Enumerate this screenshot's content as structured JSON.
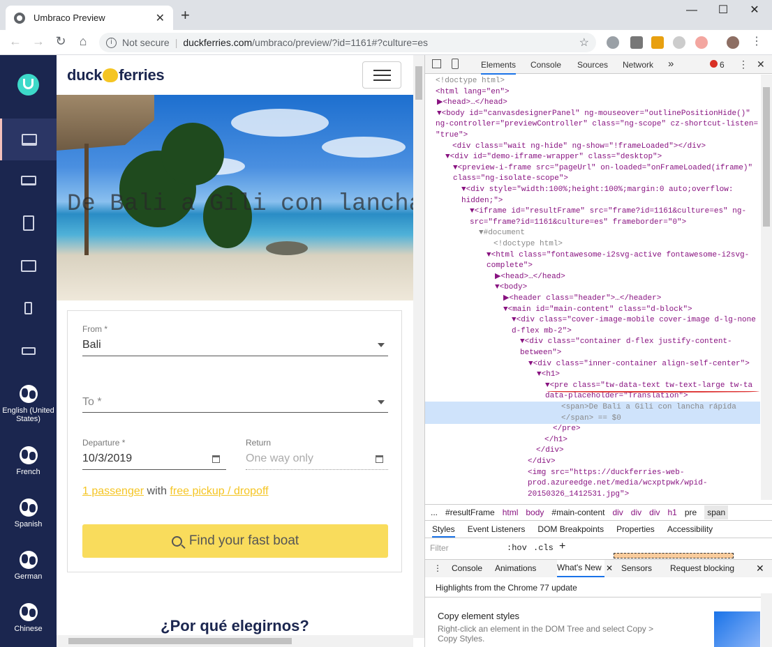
{
  "browser": {
    "tab_title": "Umbraco Preview",
    "tab_close": "✕",
    "new_tab": "+",
    "win_min": "—",
    "win_max": "☐",
    "win_close": "✕",
    "back": "←",
    "forward": "→",
    "reload": "↻",
    "home": "⌂",
    "not_secure": "Not secure",
    "sep": "|",
    "url_domain": "duckferries.com",
    "url_path": "/umbraco/preview/?id=1161#?culture=es",
    "star": "☆",
    "menu": "⋮"
  },
  "sidebar": {
    "languages": [
      {
        "label": "English (United States)"
      },
      {
        "label": "French"
      },
      {
        "label": "Spanish"
      },
      {
        "label": "German"
      },
      {
        "label": "Chinese"
      }
    ]
  },
  "site": {
    "brand_left": "duck",
    "brand_right": "ferries",
    "hero_title": "De Bali a Gili con lancha rápida",
    "from_label": "From *",
    "from_value": "Bali",
    "to_placeholder": "To *",
    "departure_label": "Departure *",
    "departure_value": "10/3/2019",
    "return_label": "Return",
    "return_placeholder": "One way only",
    "passenger_link": "1 passenger",
    "with_text": "with",
    "pickup_link": "free pickup / dropoff",
    "find_button": "Find your fast boat",
    "why_heading": "¿Por qué elegirnos?"
  },
  "devtools": {
    "tabs": [
      "Elements",
      "Console",
      "Sources",
      "Network",
      "»"
    ],
    "error_count": "6",
    "lines": [
      "<!doctype html>",
      "<html lang=\"en\">",
      "▶<head>…</head>",
      "▼<body id=\"canvasdesignerPanel\" ng-mouseover=\"outlinePositionHide()\"",
      "ng-controller=\"previewController\" class=\"ng-scope\" cz-shortcut-listen=",
      "\"true\">",
      "<div class=\"wait ng-hide\" ng-show=\"!frameLoaded\"></div>",
      "▼<div id=\"demo-iframe-wrapper\" class=\"desktop\">",
      "▼<preview-i-frame src=\"pageUrl\" on-loaded=\"onFrameLoaded(iframe)\"",
      "class=\"ng-isolate-scope\">",
      "▼<div style=\"width:100%;height:100%;margin:0 auto;overflow:",
      "hidden;\">",
      "▼<iframe id=\"resultFrame\" src=\"frame?id=1161&culture=es\" ng-",
      "src=\"frame?id=1161&culture=es\" frameborder=\"0\">",
      "▼#document",
      "<!doctype html>",
      "▼<html class=\"fontawesome-i2svg-active fontawesome-i2svg-",
      "complete\">",
      "▶<head>…</head>",
      "▼<body>",
      "▶<header class=\"header\">…</header>",
      "▼<main id=\"main-content\" class=\"d-block\">",
      "▼<div class=\"cover-image-mobile cover-image d-lg-none",
      "d-flex mb-2\">",
      "▼<div class=\"container d-flex justify-content-",
      "between\">",
      "▼<div class=\"inner-container align-self-center\">",
      "▼<h1>",
      "▼<pre class=\"tw-data-text tw-text-large tw-ta",
      "data-placeholder=\"Translation\">",
      "<span>De Bali a Gili con lancha rápida",
      "</span> == $0",
      "</pre>",
      "</h1>",
      "</div>",
      "</div>",
      "<img src=\"https://duckferries-web-",
      "prod.azureedge.net/media/wcxptpwk/wpid-",
      "20150326_1412531.jpg\">"
    ],
    "breadcrumbs": [
      "...",
      "#resultFrame",
      "html",
      "body",
      "#main-content",
      "div",
      "div",
      "div",
      "h1",
      "pre",
      "span"
    ],
    "panel_tabs": [
      "Styles",
      "Event Listeners",
      "DOM Breakpoints",
      "Properties",
      "Accessibility"
    ],
    "filter_placeholder": "Filter",
    "hov": ":hov",
    "cls": ".cls",
    "plus": "+",
    "drawer_tabs": [
      "Console",
      "Animations",
      "What's New",
      "Sensors",
      "Request blocking"
    ],
    "whats_new_heading": "Highlights from the Chrome 77 update",
    "whats_new_item_title": "Copy element styles",
    "whats_new_item_desc1": "Right-click an element in the DOM Tree and select Copy >",
    "whats_new_item_desc2": "Copy Styles."
  }
}
